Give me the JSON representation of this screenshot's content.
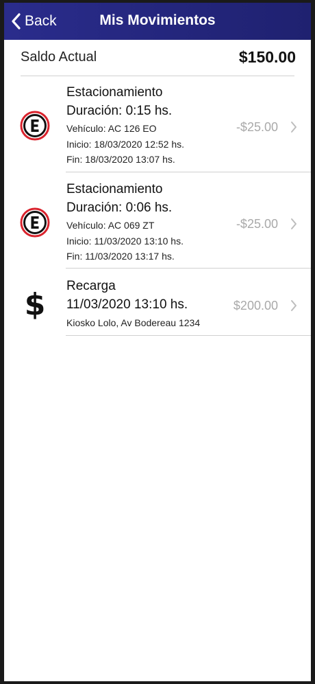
{
  "navbar": {
    "back_label": "Back",
    "title": "Mis Movimientos"
  },
  "balance": {
    "label": "Saldo Actual",
    "value": "$150.00"
  },
  "movements": [
    {
      "icon": "parking-icon",
      "title": "Estacionamiento",
      "subtitle": "Duración: 0:15 hs.",
      "vehicle": "Vehículo: AC 126 EO",
      "start": "Inicio: 18/03/2020 12:52 hs.",
      "end": "Fin: 18/03/2020 13:07 hs.",
      "amount": "-$25.00"
    },
    {
      "icon": "parking-icon",
      "title": "Estacionamiento",
      "subtitle": "Duración: 0:06 hs.",
      "vehicle": "Vehículo: AC 069 ZT",
      "start": "Inicio: 11/03/2020 13:10 hs.",
      "end": "Fin: 11/03/2020 13:17 hs.",
      "amount": "-$25.00"
    },
    {
      "icon": "dollar-icon",
      "title": "Recarga",
      "subtitle": "11/03/2020 13:10 hs.",
      "location": "Kiosko Lolo, Av Bodereau 1234",
      "amount": "$200.00"
    }
  ],
  "colors": {
    "navbar": "#2a2c8c",
    "amount": "#a9a9a9",
    "parking_ring": "#d9232d"
  }
}
